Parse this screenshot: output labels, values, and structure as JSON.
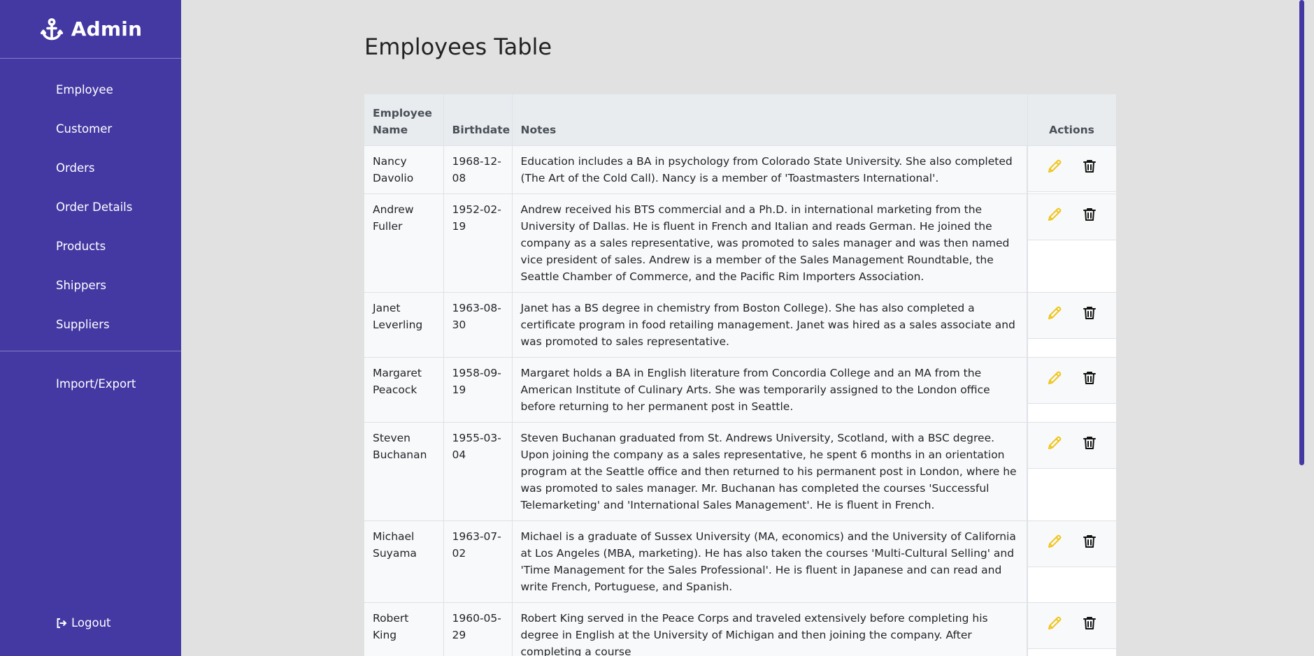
{
  "sidebar": {
    "brand": "Admin",
    "brand_icon": "anchor-icon",
    "items": [
      {
        "label": "Employee"
      },
      {
        "label": "Customer"
      },
      {
        "label": "Orders"
      },
      {
        "label": "Order Details"
      },
      {
        "label": "Products"
      },
      {
        "label": "Shippers"
      },
      {
        "label": "Suppliers"
      }
    ],
    "secondary": [
      {
        "label": "Import/Export"
      }
    ],
    "logout_label": "Logout"
  },
  "page": {
    "title": "Employees Table"
  },
  "table": {
    "headers": {
      "name": "Employee Name",
      "birthdate": "Birthdate",
      "notes": "Notes",
      "actions": "Actions"
    },
    "rows": [
      {
        "name": "Nancy Davolio",
        "birthdate": "1968-12-08",
        "notes": "Education includes a BA in psychology from Colorado State University. She also completed (The Art of the Cold Call). Nancy is a member of 'Toastmasters International'."
      },
      {
        "name": "Andrew Fuller",
        "birthdate": "1952-02-19",
        "notes": "Andrew received his BTS commercial and a Ph.D. in international marketing from the University of Dallas. He is fluent in French and Italian and reads German. He joined the company as a sales representative, was promoted to sales manager and was then named vice president of sales. Andrew is a member of the Sales Management Roundtable, the Seattle Chamber of Commerce, and the Pacific Rim Importers Association."
      },
      {
        "name": "Janet Leverling",
        "birthdate": "1963-08-30",
        "notes": "Janet has a BS degree in chemistry from Boston College). She has also completed a certificate program in food retailing management. Janet was hired as a sales associate and was promoted to sales representative."
      },
      {
        "name": "Margaret Peacock",
        "birthdate": "1958-09-19",
        "notes": "Margaret holds a BA in English literature from Concordia College and an MA from the American Institute of Culinary Arts. She was temporarily assigned to the London office before returning to her permanent post in Seattle."
      },
      {
        "name": "Steven Buchanan",
        "birthdate": "1955-03-04",
        "notes": "Steven Buchanan graduated from St. Andrews University, Scotland, with a BSC degree. Upon joining the company as a sales representative, he spent 6 months in an orientation program at the Seattle office and then returned to his permanent post in London, where he was promoted to sales manager. Mr. Buchanan has completed the courses 'Successful Telemarketing' and 'International Sales Management'. He is fluent in French."
      },
      {
        "name": "Michael Suyama",
        "birthdate": "1963-07-02",
        "notes": "Michael is a graduate of Sussex University (MA, economics) and the University of California at Los Angeles (MBA, marketing). He has also taken the courses 'Multi-Cultural Selling' and 'Time Management for the Sales Professional'. He is fluent in Japanese and can read and write French, Portuguese, and Spanish."
      },
      {
        "name": "Robert King",
        "birthdate": "1960-05-29",
        "notes": "Robert King served in the Peace Corps and traveled extensively before completing his degree in English at the University of Michigan and then joining the company. After completing a course"
      }
    ],
    "action_icons": {
      "edit": "pencil-icon",
      "delete": "trash-icon"
    }
  },
  "colors": {
    "sidebar_bg": "#4439a3",
    "page_bg": "#e1e1e1",
    "edit_icon": "#f0c419",
    "delete_icon": "#111111"
  }
}
